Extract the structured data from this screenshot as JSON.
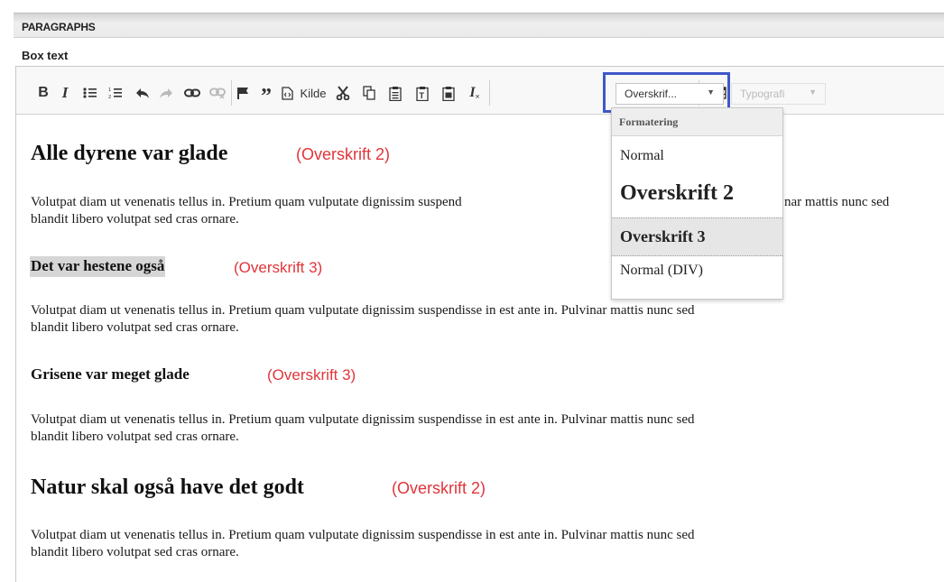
{
  "section": {
    "title": "PARAGRAPHS"
  },
  "field": {
    "label": "Box text"
  },
  "toolbar": {
    "bold": "B",
    "italic": "I",
    "source_label": "Kilde",
    "format_combo": "Overskrif...",
    "style_combo": "Typografi"
  },
  "dropdown": {
    "header": "Formatering",
    "items": [
      "Normal",
      "Overskrift 2",
      "Overskrift 3",
      "Normal (DIV)"
    ]
  },
  "content": {
    "blocks": [
      {
        "heading": "Alle dyrene var glade",
        "note": "(Overskrift 2)"
      },
      {
        "paragraph_line1": "Volutpat diam ut venenatis tellus in. Pretium quam vulputate dignissim suspend",
        "paragraph_line1_end": "nar mattis nunc sed",
        "paragraph_line2": "blandit libero volutpat sed cras ornare."
      },
      {
        "heading": "Det var hestene også",
        "note": "(Overskrift 3)"
      },
      {
        "paragraph_line1": "Volutpat diam ut venenatis tellus in. Pretium quam vulputate dignissim suspendisse in est ante in. Pulvinar mattis nunc sed",
        "paragraph_line2": "blandit libero volutpat sed cras ornare."
      },
      {
        "heading": "Grisene var meget glade",
        "note": "(Overskrift 3)"
      },
      {
        "paragraph_line1": "Volutpat diam ut venenatis tellus in. Pretium quam vulputate dignissim suspendisse in est ante in. Pulvinar mattis nunc sed",
        "paragraph_line2": "blandit libero volutpat sed cras ornare."
      },
      {
        "heading": "Natur skal også have det godt",
        "note": "(Overskrift 2)"
      },
      {
        "paragraph_line1": "Volutpat diam ut venenatis tellus in. Pretium quam vulputate dignissim suspendisse in est ante in. Pulvinar mattis nunc sed",
        "paragraph_line2": "blandit libero volutpat sed cras ornare."
      }
    ]
  },
  "colors": {
    "highlight_border": "#3f58c8",
    "annotation_red": "#e0353a"
  }
}
